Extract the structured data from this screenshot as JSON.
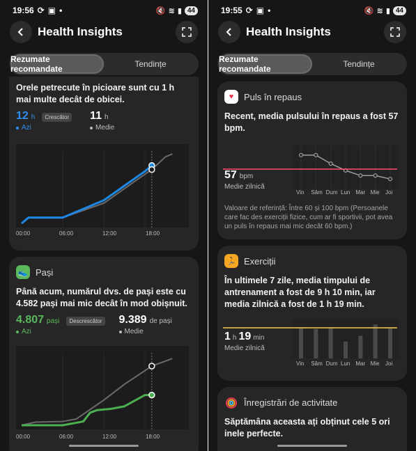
{
  "left": {
    "status": {
      "time": "19:56",
      "battery": "44"
    },
    "header": {
      "title": "Health Insights"
    },
    "tabs": [
      {
        "label": "Rezumate recomandate",
        "active": true
      },
      {
        "label": "Tendințe",
        "active": false
      }
    ],
    "standing": {
      "text": "Orele petrecute în picioare sunt cu 1 h mai multe decât de obicei.",
      "today_value": "12",
      "today_unit": "h",
      "today_label": "Azi",
      "trend_badge": "Crescător",
      "avg_value": "11",
      "avg_unit": "h",
      "avg_label": "Medie",
      "chart_data": {
        "type": "line",
        "x_ticks": [
          "00:00",
          "06:00",
          "12:00",
          "18:00"
        ],
        "series": [
          {
            "color": "#1e88e5",
            "points": [
              [
                0,
                0
              ],
              [
                1,
                1
              ],
              [
                6,
                1
              ],
              [
                12,
                4
              ],
              [
                18,
                9
              ],
              [
                19,
                10
              ]
            ]
          },
          {
            "color": "#6a6a6a",
            "points": [
              [
                0,
                0
              ],
              [
                1,
                1
              ],
              [
                6,
                1
              ],
              [
                12,
                3.5
              ],
              [
                18,
                8.5
              ],
              [
                19,
                9.3
              ],
              [
                21,
                11.5
              ],
              [
                22,
                12
              ]
            ]
          }
        ]
      }
    },
    "steps": {
      "title": "Pași",
      "text": "Până acum, numărul dvs. de pași este cu 4.582 pași mai mic decât în mod obișnuit.",
      "today_value": "4.807",
      "today_unit": "pași",
      "today_label": "Azi",
      "trend_badge": "Descrescător",
      "avg_value": "9.389",
      "avg_unit": "de pași",
      "avg_label": "Medie",
      "chart_data": {
        "type": "line",
        "x_ticks": [
          "00:00",
          "06:00",
          "12:00",
          "18:00"
        ],
        "series": [
          {
            "color": "#4caf50",
            "points": [
              [
                0,
                0
              ],
              [
                6,
                0
              ],
              [
                9,
                0.6
              ],
              [
                10,
                2
              ],
              [
                11,
                2.4
              ],
              [
                13,
                2.6
              ],
              [
                15,
                3
              ],
              [
                18,
                4.8
              ],
              [
                19,
                4.8
              ]
            ]
          },
          {
            "color": "#6a6a6a",
            "points": [
              [
                0,
                0
              ],
              [
                2,
                0.5
              ],
              [
                6,
                0.6
              ],
              [
                8,
                1
              ],
              [
                12,
                4
              ],
              [
                15,
                6.5
              ],
              [
                19,
                9.4
              ],
              [
                22,
                10.6
              ]
            ]
          }
        ]
      }
    }
  },
  "right": {
    "status": {
      "time": "19:55",
      "battery": "44"
    },
    "header": {
      "title": "Health Insights"
    },
    "tabs": [
      {
        "label": "Rezumate recomandate",
        "active": true
      },
      {
        "label": "Tendințe",
        "active": false
      }
    ],
    "pulse": {
      "title": "Puls în repaus",
      "text": "Recent, media pulsului în repaus a fost 57 bpm.",
      "value": "57",
      "unit": "bpm",
      "label": "Medie zilnică",
      "note": "Valoare de referință: Între 60 și 100 bpm (Persoanele care fac des exerciții fizice, cum ar fi sportivii, pot avea un puls în repaus mai mic decât 60 bpm.)",
      "chart_data": {
        "type": "line",
        "categories": [
          "Vin",
          "Sâm",
          "Dum",
          "Lun",
          "Mar",
          "Mie",
          "Joi"
        ],
        "values": [
          66,
          66,
          61,
          57,
          54,
          54,
          52
        ],
        "average": 57,
        "colors": {
          "line": "#9e9e9e",
          "average": "#ff4d6d"
        }
      }
    },
    "exercise": {
      "title": "Exerciții",
      "text": "În ultimele 7 zile, media timpului de antrenament a fost de 9 h 10 min, iar media zilnică a fost de 1 h 19 min.",
      "value_h": "1",
      "unit_h": "h",
      "value_m": "19",
      "unit_m": "min",
      "label": "Medie zilnică",
      "chart_data": {
        "type": "bar",
        "categories": [
          "Vin",
          "Sâm",
          "Dum",
          "Lun",
          "Mar",
          "Mie",
          "Joi"
        ],
        "values": [
          1.35,
          1.3,
          1.35,
          0.75,
          1.0,
          1.5,
          1.35
        ],
        "average": 1.32,
        "colors": {
          "bar": "#4a4a4a",
          "average": "#f2c94c"
        }
      }
    },
    "activity": {
      "title": "Înregistrări de activitate",
      "text": "Săptămâna aceasta ați obținut cele 5 ori inele perfecte."
    }
  }
}
